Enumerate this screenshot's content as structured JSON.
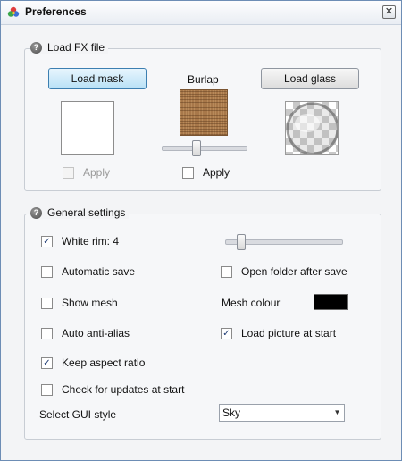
{
  "window": {
    "title": "Preferences",
    "close_symbol": "✕"
  },
  "load_fx": {
    "group_title": "Load FX file",
    "load_mask_label": "Load mask",
    "center_label": "Burlap",
    "load_glass_label": "Load glass",
    "mask_apply_label": "Apply",
    "burlap_apply_label": "Apply",
    "mask_apply_checked": false,
    "burlap_apply_checked": false,
    "burlap_slider_fraction": 0.4
  },
  "general": {
    "group_title": "General settings",
    "white_rim_label": "White rim: 4",
    "white_rim_checked": true,
    "white_rim_slider_fraction": 0.1,
    "automatic_save_label": "Automatic save",
    "automatic_save_checked": false,
    "open_folder_label": "Open folder after save",
    "open_folder_checked": false,
    "show_mesh_label": "Show mesh",
    "show_mesh_checked": false,
    "mesh_colour_label": "Mesh colour",
    "mesh_colour": "#000000",
    "auto_anti_alias_label": "Auto anti-alias",
    "auto_anti_alias_checked": false,
    "load_picture_label": "Load picture at start",
    "load_picture_checked": true,
    "keep_aspect_label": "Keep aspect ratio",
    "keep_aspect_checked": true,
    "check_updates_label": "Check for updates at start",
    "check_updates_checked": false,
    "gui_style_label": "Select GUI style",
    "gui_style_value": "Sky"
  },
  "icons": {
    "app": "colour-palette-icon",
    "help": "help-icon",
    "check": "checkmark-icon",
    "dropdown": "chevron-down-icon"
  },
  "check_mark": "✓",
  "help_mark": "?",
  "dropdown_arrow": "▼"
}
